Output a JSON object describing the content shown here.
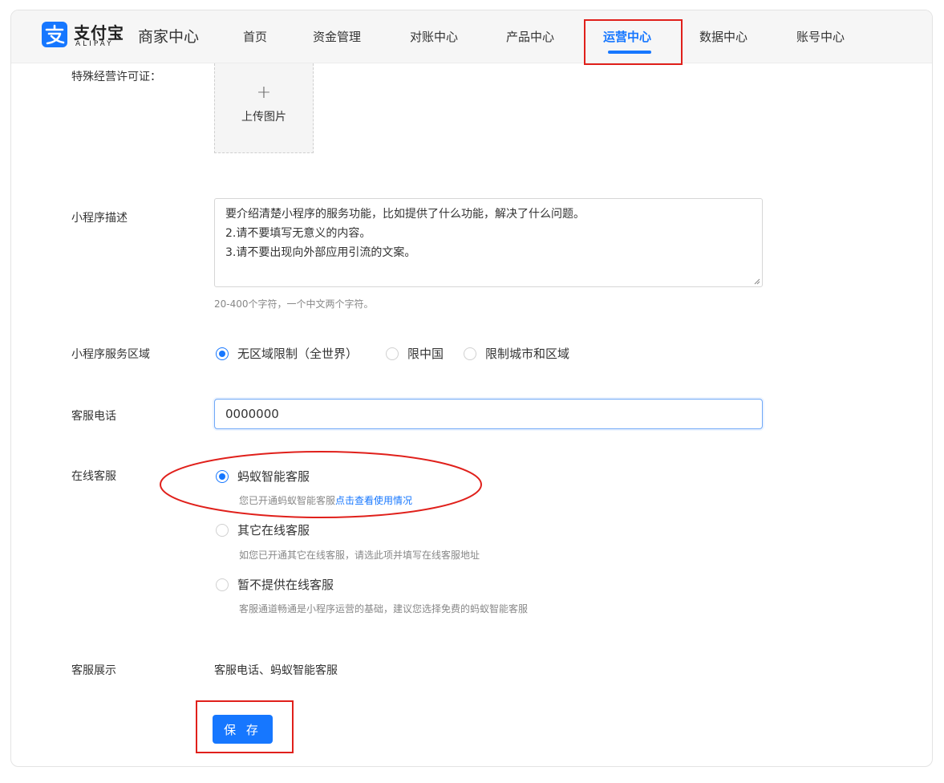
{
  "header": {
    "brand_cn": "支付宝",
    "brand_en": "ALIPAY",
    "app_name": "商家中心",
    "nav": [
      {
        "label": "首页"
      },
      {
        "label": "资金管理"
      },
      {
        "label": "对账中心"
      },
      {
        "label": "产品中心"
      },
      {
        "label": "运营中心",
        "active": true
      },
      {
        "label": "数据中心"
      },
      {
        "label": "账号中心"
      }
    ],
    "accent": "#1677ff"
  },
  "form": {
    "license": {
      "label": "特殊经营许可证：",
      "upload_icon": "+",
      "upload_text": "上传图片"
    },
    "description": {
      "label": "小程序描述",
      "lines": [
        "要介绍清楚小程序的服务功能，比如提供了什么功能，解决了什么问题。",
        "2.请不要填写无意义的内容。",
        "3.请不要出现向外部应用引流的文案。"
      ],
      "hint": "20-400个字符，一个中文两个字符。"
    },
    "region": {
      "label": "小程序服务区域",
      "options": [
        {
          "label": "无区域限制（全世界）",
          "checked": true
        },
        {
          "label": "限中国",
          "checked": false
        },
        {
          "label": "限制城市和区域",
          "checked": false
        }
      ]
    },
    "phone": {
      "label": "客服电话",
      "value": "0000000"
    },
    "online_service": {
      "label": "在线客服",
      "options": [
        {
          "label": "蚂蚁智能客服",
          "checked": true,
          "desc": "您已开通蚂蚁智能客服",
          "link": "点击查看使用情况"
        },
        {
          "label": "其它在线客服",
          "checked": false,
          "desc": "如您已开通其它在线客服，请选此项并填写在线客服地址"
        },
        {
          "label": "暂不提供在线客服",
          "checked": false,
          "desc": "客服通道畅通是小程序运营的基础，建议您选择免费的蚂蚁智能客服"
        }
      ]
    },
    "display": {
      "label": "客服展示",
      "value": "客服电话、蚂蚁智能客服"
    },
    "save_label": "保 存"
  },
  "annotation_color": "#e0201b"
}
